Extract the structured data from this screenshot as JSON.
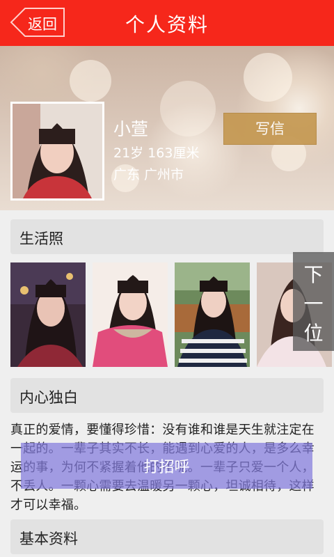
{
  "header": {
    "back_label": "返回",
    "title": "个人资料"
  },
  "profile": {
    "name": "小萱",
    "age_height": "21岁  163厘米",
    "location": "广东  广州市",
    "write_label": "写信"
  },
  "sections": {
    "photos_title": "生活照",
    "monologue_title": "内心独白",
    "basic_title": "基本资料"
  },
  "monologue_text": "真正的爱情，要懂得珍惜：没有谁和谁是天生就注定在一起的。一辈子其实不长，能遇到心爱的人，是多么幸运的事，为何不紧握着他的手呢。一辈子只爱一个人，不丢人。一颗心需要去温暖另一颗心，坦诚相待，这样才可以幸福。",
  "next_label": [
    "下",
    "一",
    "位"
  ],
  "greet_label": "打招呼",
  "colors": {
    "topbar": "#f6271b",
    "write_button": "#c4974f",
    "overlay": "#827ADC"
  }
}
